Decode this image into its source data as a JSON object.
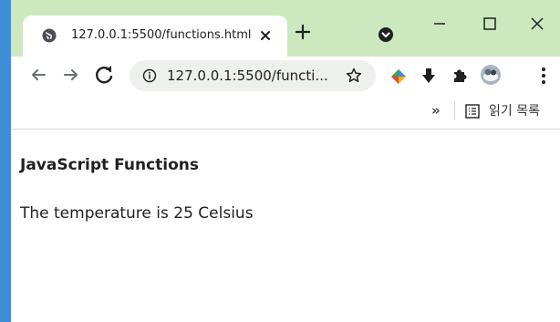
{
  "browser": {
    "tab": {
      "title": "127.0.0.1:5500/functions.html"
    },
    "toolbar": {
      "url": "127.0.0.1:5500/functi..."
    },
    "bookmarks_bar": {
      "more_label": "»",
      "reading_list_label": "읽기 목록"
    }
  },
  "page": {
    "heading": "JavaScript Functions",
    "paragraph": "The temperature is 25 Celsius"
  }
}
